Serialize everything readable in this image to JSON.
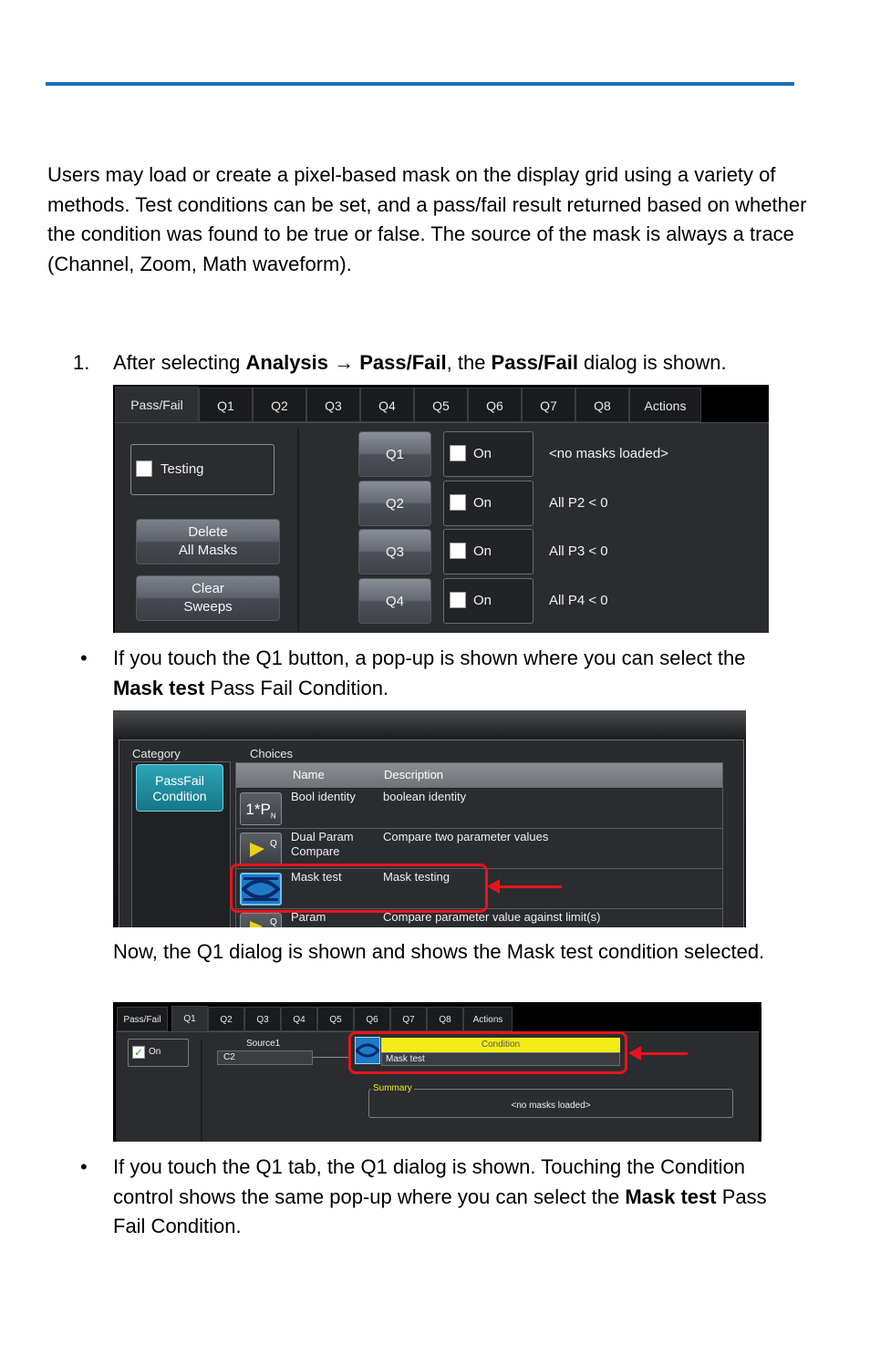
{
  "intro": {
    "text": "Users may load or create a pixel-based mask on the display grid using a variety of methods. Test conditions can be set, and a pass/fail result returned based on whether the condition was found to be true or false. The source of the mask is always a trace (Channel, Zoom, Math waveform)."
  },
  "step1": {
    "number": "1.",
    "t1": "After selecting ",
    "b1": "Analysis → Pass/Fail",
    "t2": ", the ",
    "b2": "Pass/Fail",
    "t3": " dialog is shown."
  },
  "bullet1": {
    "symbol": "•",
    "t1": "If you touch the Q1 button, a pop-up is shown where you can select the ",
    "b1": "Mask test",
    "t2": " Pass Fail Condition."
  },
  "note": {
    "text": "Now, the Q1 dialog is shown and shows the Mask test condition selected."
  },
  "bullet2": {
    "symbol": "•",
    "t1": "If you touch the Q1 tab, the Q1 dialog is shown. Touching the Condition control shows the same pop-up where you can select the ",
    "b1": "Mask test",
    "t2": " Pass Fail Condition."
  },
  "dialog1": {
    "tabs": [
      "Pass/Fail",
      "Q1",
      "Q2",
      "Q3",
      "Q4",
      "Q5",
      "Q6",
      "Q7",
      "Q8",
      "Actions"
    ],
    "testing_label": "Testing",
    "delete_line1": "Delete",
    "delete_line2": "All Masks",
    "clear_line1": "Clear",
    "clear_line2": "Sweeps",
    "rows": [
      {
        "button": "Q1",
        "on": "On",
        "desc": "<no masks loaded>"
      },
      {
        "button": "Q2",
        "on": "On",
        "desc": "All P2 < 0"
      },
      {
        "button": "Q3",
        "on": "On",
        "desc": "All P3 < 0"
      },
      {
        "button": "Q4",
        "on": "On",
        "desc": "All P4 < 0"
      }
    ]
  },
  "popup": {
    "category_label": "Category",
    "choices_label": "Choices",
    "category_item_line1": "PassFail",
    "category_item_line2": "Condition",
    "col_name": "Name",
    "col_desc": "Description",
    "rows": [
      {
        "icon": "1*P",
        "name": "Bool identity",
        "desc": "boolean identity"
      },
      {
        "icon": "Q",
        "name": "Dual Param Compare",
        "desc": "Compare two parameter values"
      },
      {
        "icon": "mask-icon",
        "name": "Mask test",
        "desc": "Mask testing"
      },
      {
        "icon": "Q",
        "name": "Param",
        "desc": "Compare parameter value against limit(s)"
      }
    ],
    "highlight_color": "#e6141c"
  },
  "dialog3": {
    "tabs": [
      "Pass/Fail",
      "Q1",
      "Q2",
      "Q3",
      "Q4",
      "Q5",
      "Q6",
      "Q7",
      "Q8",
      "Actions"
    ],
    "on_label": "On",
    "check": "✓",
    "source_label": "Source1",
    "source_value": "C2",
    "condition_label": "Condition",
    "condition_value": "Mask test",
    "summary_label": "Summary",
    "summary_value": "<no masks loaded>"
  },
  "colors": {
    "rule": "#1f6fb7",
    "condition_header": "#f2ed19",
    "accent_teal": "#2ea4b8"
  }
}
